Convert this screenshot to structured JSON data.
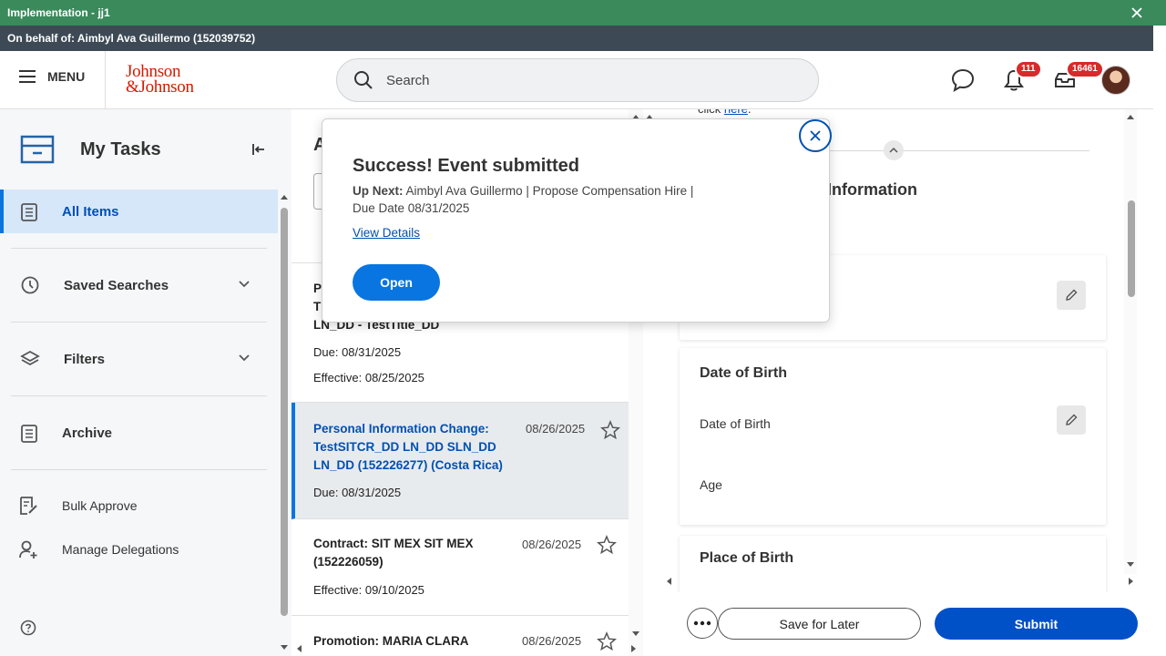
{
  "env": {
    "title": "Implementation - jj1"
  },
  "behalf": {
    "text": "On behalf of: Aimbyl Ava Guillermo (152039752)"
  },
  "header": {
    "menu_label": "MENU",
    "logo_line1": "Johnson",
    "logo_line2": "&Johnson",
    "search_placeholder": "Search",
    "notifications_count": "111",
    "inbox_count": "16461"
  },
  "sidebar": {
    "title": "My Tasks",
    "items": [
      {
        "label": "All Items"
      },
      {
        "label": "Saved Searches"
      },
      {
        "label": "Filters"
      },
      {
        "label": "Archive"
      },
      {
        "label": "Bulk Approve"
      },
      {
        "label": "Manage Delegations"
      }
    ]
  },
  "list": {
    "heading": "A",
    "tasks": [
      {
        "title_l1": "P",
        "title_l2": "T",
        "title_l3": "LN_DD - TestTitle_DD",
        "line1": "Due: 08/31/2025",
        "line2": "Effective: 08/25/2025"
      },
      {
        "title": "Personal Information Change: TestSITCR_DD LN_DD SLN_DD LN_DD (152226277) (Costa Rica)",
        "date": "08/26/2025",
        "line1": "Due: 08/31/2025"
      },
      {
        "title": "Contract: SIT MEX SIT MEX (152226059)",
        "date": "08/26/2025",
        "line1": "Effective: 09/10/2025"
      },
      {
        "title": "Promotion: MARIA CLARA",
        "date": "08/26/2025"
      }
    ]
  },
  "detail": {
    "link_prefix": "click ",
    "link_text": "here",
    "link_suffix": ".",
    "section_title": "Information",
    "card2_title": "Date of Birth",
    "card2_label1": "Date of Birth",
    "card2_label2": "Age",
    "card3_title": "Place of Birth"
  },
  "footer": {
    "save_label": "Save for Later",
    "submit_label": "Submit"
  },
  "popup": {
    "title": "Success! Event submitted",
    "up_next_label": "Up Next:",
    "up_next_text": "Aimbyl Ava Guillermo | Propose Compensation Hire |",
    "due_text": "Due Date 08/31/2025",
    "link": "View Details",
    "open_label": "Open"
  }
}
